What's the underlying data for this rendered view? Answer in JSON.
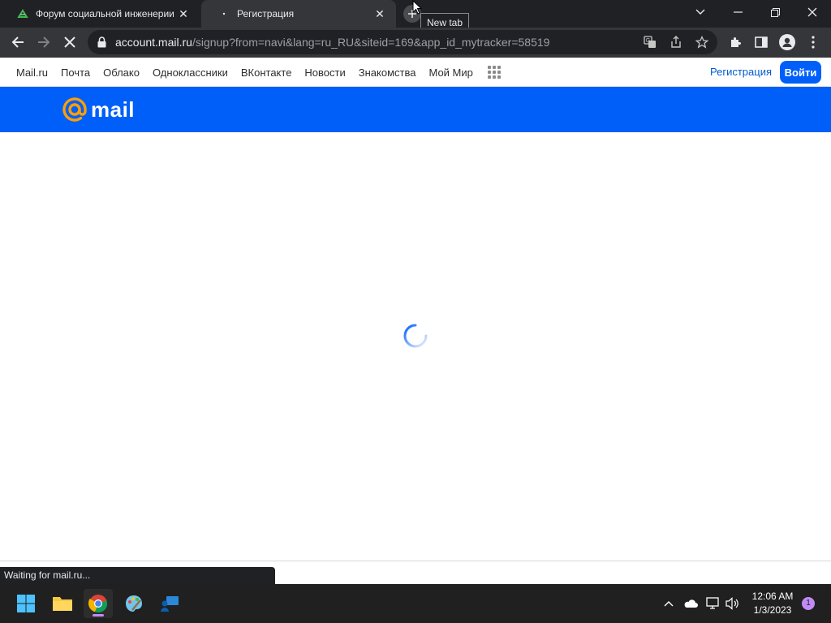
{
  "browser": {
    "tabs": [
      {
        "title": "Форум социальной инженерии",
        "active": false
      },
      {
        "title": "Регистрация",
        "active": true
      }
    ],
    "tooltip": "New tab",
    "url_host": "account.mail.ru",
    "url_path": "/signup?from=navi&lang=ru_RU&siteid=169&app_id_mytracker=58519"
  },
  "sitenav": {
    "links": [
      "Mail.ru",
      "Почта",
      "Облако",
      "Одноклассники",
      "ВКонтакте",
      "Новости",
      "Знакомства",
      "Мой Мир"
    ],
    "register": "Регистрация",
    "login": "Войти"
  },
  "banner": {
    "logo_text": "mail",
    "bg_color": "#005ff9",
    "at_color": "#ff9e00"
  },
  "status": "Waiting for mail.ru...",
  "taskbar": {
    "time": "12:06 AM",
    "date": "1/3/2023",
    "notifications": "1",
    "apps": [
      "windows-start-icon",
      "file-explorer-icon",
      "chrome-icon",
      "paint-icon",
      "remote-desktop-icon"
    ]
  }
}
